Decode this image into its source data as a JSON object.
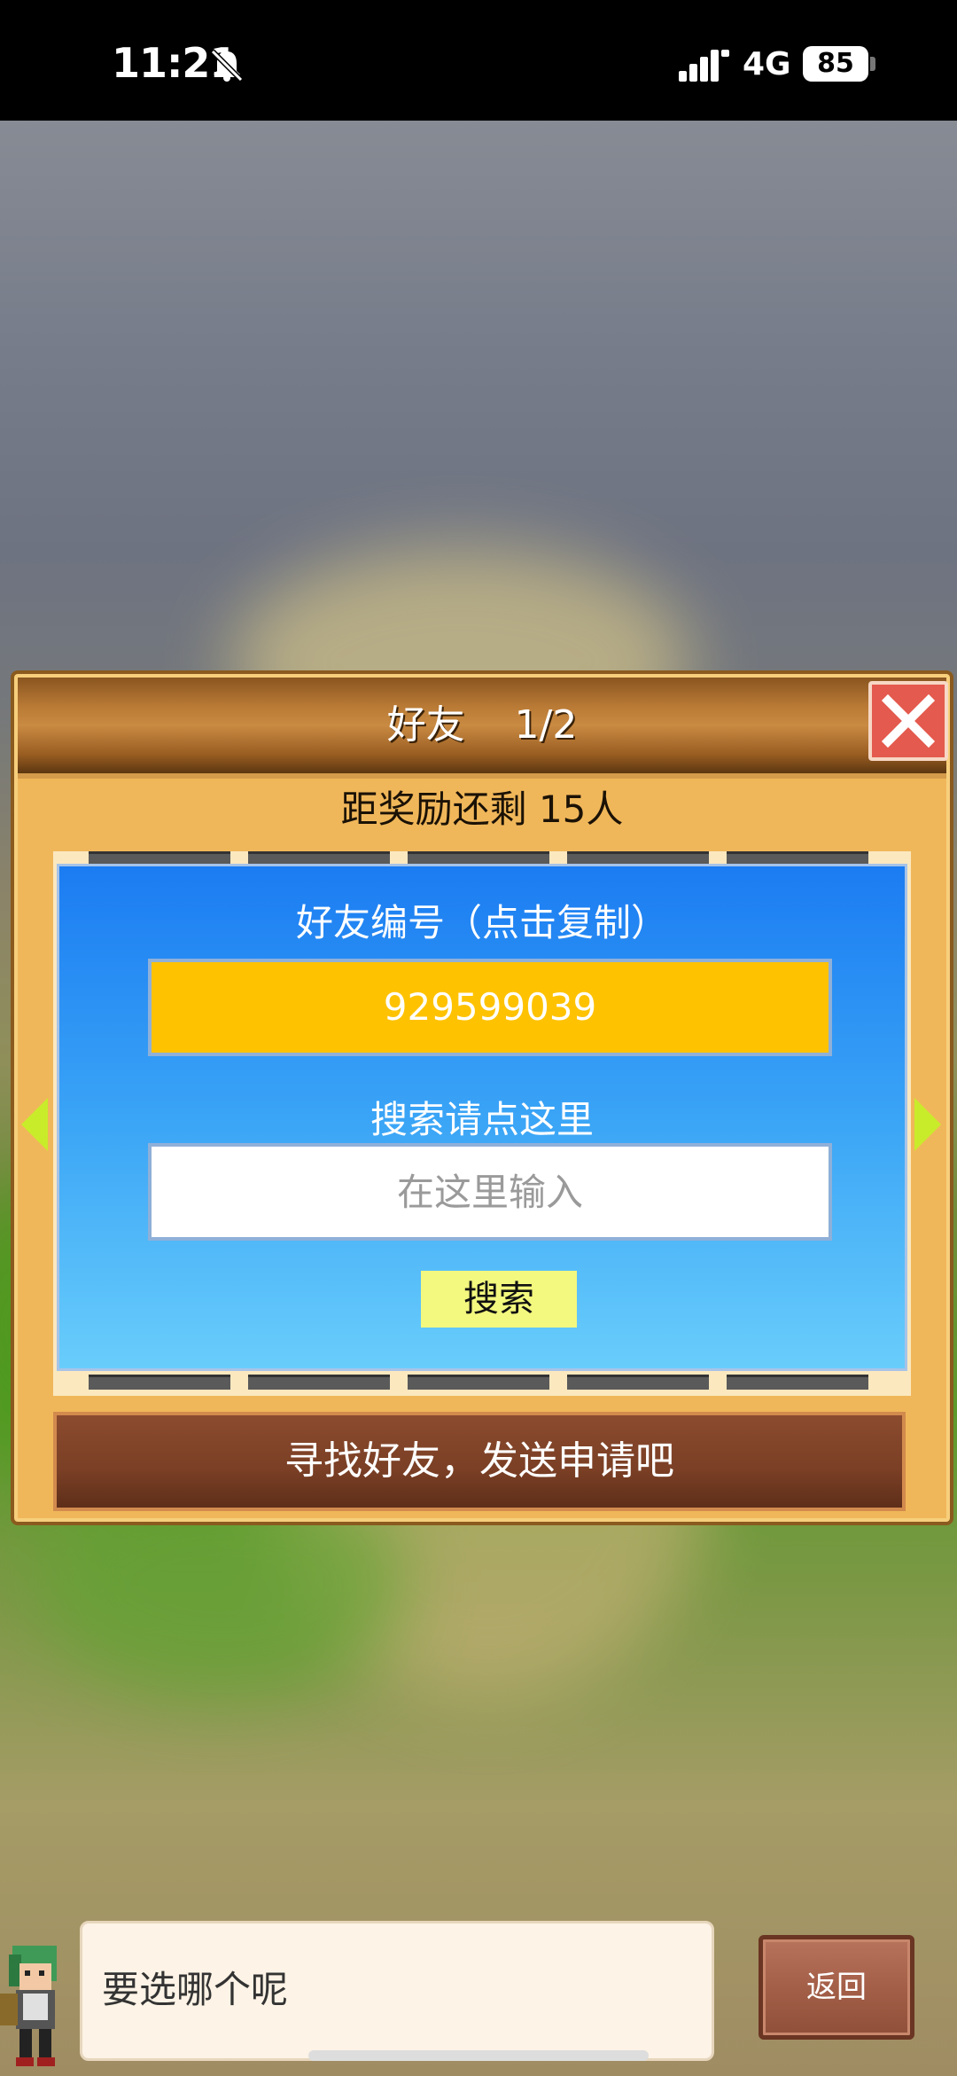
{
  "status_bar": {
    "time": "11:21",
    "network": "4G",
    "battery": "85"
  },
  "dialog": {
    "title": "好友    1/2",
    "reward_text": "距奖励还剩 15人",
    "friend_id_label": "好友编号（点击复制）",
    "friend_id_value": "929599039",
    "search_label": "搜索请点这里",
    "search_placeholder": "在这里输入",
    "search_button": "搜索",
    "banner_text": "寻找好友，发送申请吧"
  },
  "bottom": {
    "speech_text": "要选哪个呢",
    "back_button": "返回"
  },
  "colors": {
    "friend_id_field": "#ffc200",
    "search_button": "#f3f87e",
    "close_button": "#e45a4e"
  }
}
